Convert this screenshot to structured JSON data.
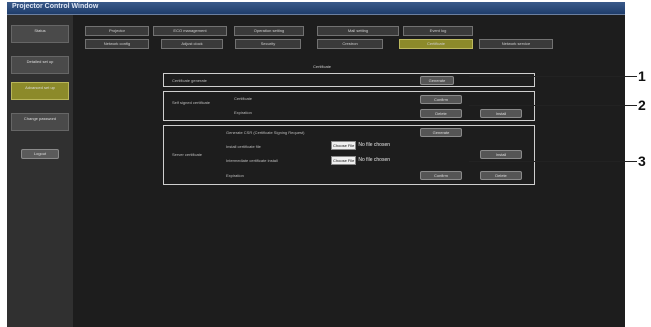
{
  "window": {
    "title": "Projector Control Window"
  },
  "sidebar": {
    "items": [
      {
        "label": "Status"
      },
      {
        "label": "Detailed set up"
      },
      {
        "label": "Advanced set up"
      },
      {
        "label": "Change password"
      }
    ],
    "logout_label": "Logout"
  },
  "tabs": {
    "row1": [
      "Projector",
      "ECO management",
      "Operation setting",
      "Mail setting",
      "Event log"
    ],
    "row2": [
      "Network config",
      "Adjust clock",
      "Security",
      "Crestron",
      "Certificate",
      "Network service"
    ]
  },
  "main": {
    "section_title": "Certificate",
    "panel1": {
      "label": "Certificate generate",
      "button": "Generate"
    },
    "panel2": {
      "group_label": "Self signed certificate",
      "row1_label": "Certificate",
      "row2_label": "Expiration",
      "btn_r1c1": "Confirm",
      "btn_r2c1": "Delete",
      "btn_r2c2": "Install"
    },
    "panel3": {
      "group_label": "Server certificate",
      "row1_label": "Generate CSR (Certificate Signing Request)",
      "row1_button": "Generate",
      "row2_label": "Install certificate file",
      "row2_file_button": "Choose File",
      "row2_file_status": "No file chosen",
      "row2_button": "Install",
      "row3_label": "Intermediate certificate install",
      "row3_file_button": "Choose File",
      "row3_file_status": "No file chosen",
      "row4_label": "Expiration",
      "row4_btn1": "Confirm",
      "row4_btn2": "Delete"
    }
  },
  "callouts": [
    "1",
    "2",
    "3"
  ]
}
